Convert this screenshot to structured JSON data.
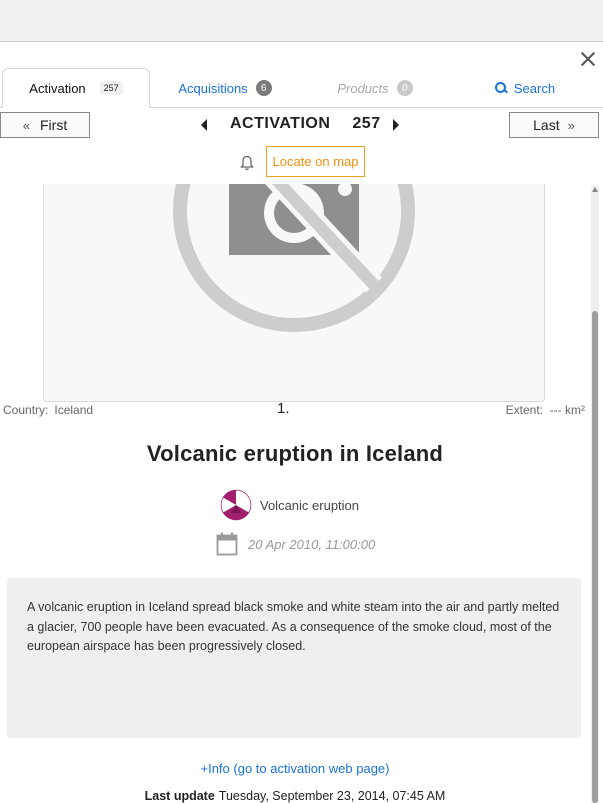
{
  "tabs": {
    "activation": {
      "label": "Activation",
      "count": "257"
    },
    "acquisitions": {
      "label": "Acquisitions",
      "count": "6"
    },
    "products": {
      "label": "Products",
      "count": "0"
    },
    "search": {
      "label": "Search"
    }
  },
  "nav": {
    "first_label": "First",
    "last_label": "Last",
    "title": "ACTIVATION",
    "number": "257"
  },
  "locate_label": "Locate on map",
  "meta": {
    "country_label": "Country:",
    "country_value": "Iceland",
    "index": "1.",
    "extent_label": "Extent:",
    "extent_value": "--- km²"
  },
  "event": {
    "title": "Volcanic eruption in Iceland",
    "type": "Volcanic eruption",
    "date": "20 Apr 2010, 11:00:00",
    "description": "A volcanic eruption in Iceland spread black smoke and white steam into the air and partly melted a glacier, 700 people have been evacuated. As a consequence of the smoke cloud, most of the european airspace has been progressively closed."
  },
  "info_link": "+Info (go to activation web page)",
  "last_update": {
    "label": "Last update",
    "value": "Tuesday, September 23, 2014, 07:45 AM"
  },
  "colors": {
    "accent_blue": "#1a73d9",
    "accent_orange": "#f09010",
    "hazard_icon": "#a0206e"
  },
  "icons": [
    "close-icon",
    "search-icon",
    "double-chevron-left-icon",
    "double-chevron-right-icon",
    "bell-icon",
    "no-image-icon",
    "volcano-hazard-icon",
    "calendar-icon"
  ]
}
